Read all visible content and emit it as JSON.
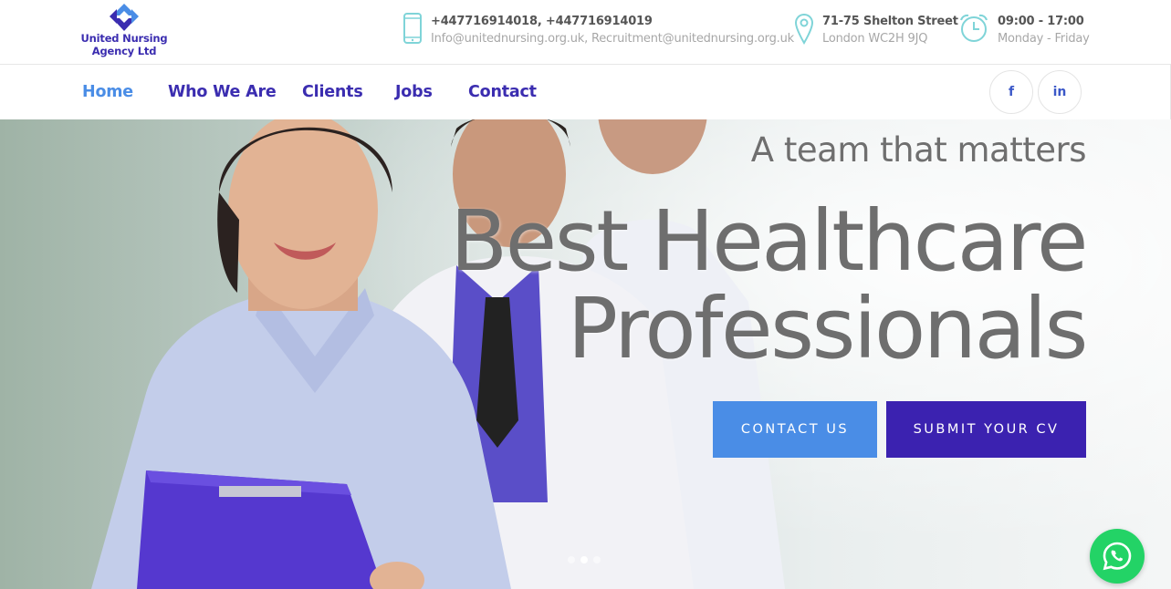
{
  "brand": {
    "name_line1": "United Nursing",
    "name_line2": "Agency Ltd",
    "logo_color": "#3b2db0",
    "logo_accent": "#4a8de6"
  },
  "contact_bar": {
    "phone": {
      "icon": "smartphone-icon",
      "line1": "+447716914018, +447716914019",
      "line2": "Info@unitednursing.org.uk, Recruitment@unitednursing.org.uk"
    },
    "address": {
      "icon": "map-pin-icon",
      "line1": "71-75 Shelton Street",
      "line2": "London WC2H 9JQ"
    },
    "hours": {
      "icon": "alarm-clock-icon",
      "line1": "09:00 - 17:00",
      "line2": "Monday - Friday"
    },
    "icon_color": "#7fd4d8"
  },
  "nav": {
    "items": [
      {
        "label": "Home",
        "active": true
      },
      {
        "label": "Who We Are",
        "active": false
      },
      {
        "label": "Clients",
        "active": false
      },
      {
        "label": "Jobs",
        "active": false
      },
      {
        "label": "Contact",
        "active": false
      }
    ],
    "social": [
      {
        "icon": "facebook-icon",
        "glyph": "f"
      },
      {
        "icon": "linkedin-icon",
        "glyph": "in"
      }
    ]
  },
  "hero": {
    "tagline": "A team that matters",
    "headline_line1": "Best Healthcare",
    "headline_line2": "Professionals",
    "buttons": {
      "contact": "CONTACT US",
      "submit_cv": "SUBMIT YOUR CV"
    },
    "slider": {
      "count": 3,
      "active": 2
    }
  },
  "floating": {
    "icon": "whatsapp-icon",
    "color": "#23d366"
  },
  "colors": {
    "primary": "#3b2db0",
    "accent": "#4a8de6",
    "button_dark": "#3b22b0"
  }
}
